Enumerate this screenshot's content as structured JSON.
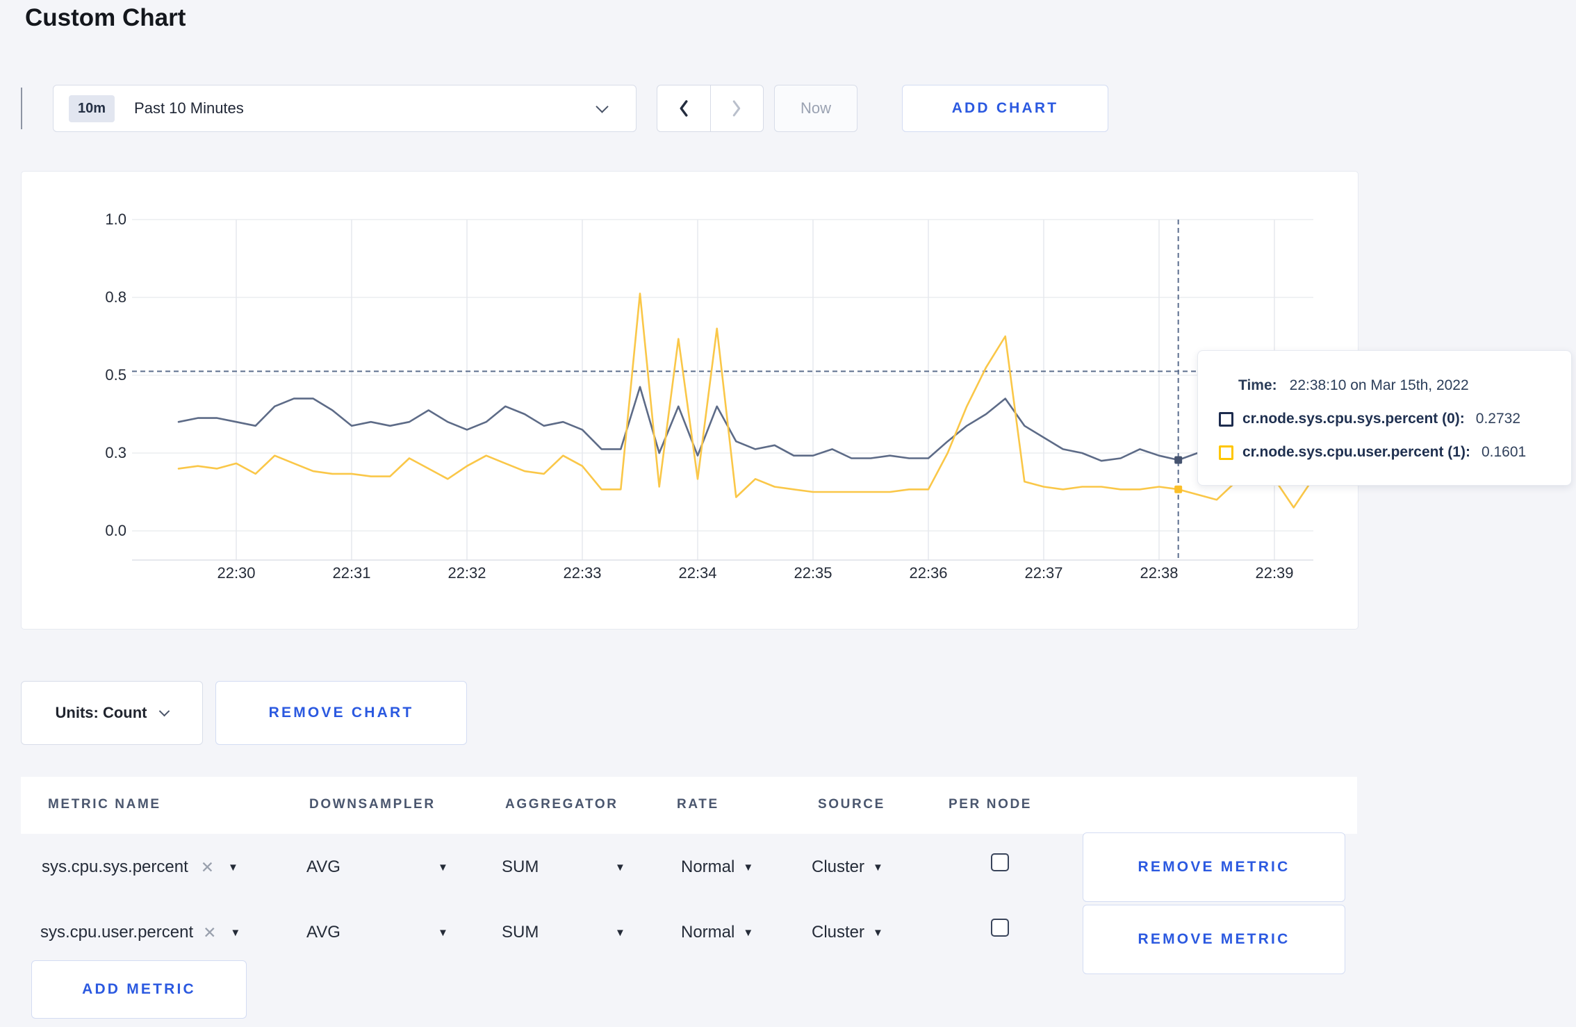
{
  "page": {
    "title": "Custom Chart"
  },
  "icons": {
    "close": "✕",
    "caret_down": "▼"
  },
  "toolbar": {
    "time_badge": "10m",
    "time_label": "Past 10 Minutes",
    "now_label": "Now",
    "add_chart_label": "ADD CHART"
  },
  "tooltip": {
    "time_label": "Time:",
    "time_value": "22:38:10 on Mar 15th, 2022",
    "series": [
      {
        "label": "cr.node.sys.cpu.sys.percent (0):",
        "value": "0.2732",
        "color": "#1d2c4e"
      },
      {
        "label": "cr.node.sys.cpu.user.percent (1):",
        "value": "0.1601",
        "color": "#ffc600"
      }
    ]
  },
  "chart_footer": {
    "units_label": "Units: Count",
    "remove_chart_label": "REMOVE CHART"
  },
  "metrics_table": {
    "headers": [
      "METRIC NAME",
      "DOWNSAMPLER",
      "AGGREGATOR",
      "RATE",
      "SOURCE",
      "PER NODE"
    ],
    "rows": [
      {
        "metric_name": "sys.cpu.sys.percent",
        "downsampler": "AVG",
        "aggregator": "SUM",
        "rate": "Normal",
        "source": "Cluster",
        "per_node_checked": false,
        "remove_label": "REMOVE METRIC"
      },
      {
        "metric_name": "sys.cpu.user.percent",
        "downsampler": "AVG",
        "aggregator": "SUM",
        "rate": "Normal",
        "source": "Cluster",
        "per_node_checked": false,
        "remove_label": "REMOVE METRIC"
      }
    ],
    "add_metric_label": "ADD METRIC"
  },
  "chart_data": {
    "type": "line",
    "title": "",
    "xlabel": "",
    "ylabel": "",
    "x_start_time": "22:29:30",
    "x_step_seconds": 10,
    "x_tick_labels": [
      "22:30",
      "22:31",
      "22:32",
      "22:33",
      "22:34",
      "22:35",
      "22:36",
      "22:37",
      "22:38",
      "22:39"
    ],
    "y_ticks": [
      {
        "value": 0,
        "label": "0.0"
      },
      {
        "value": 0.3,
        "label": "0.3"
      },
      {
        "value": 0.5,
        "label": "0.5"
      },
      {
        "value": 0.8,
        "label": "0.8"
      },
      {
        "value": 1.0,
        "label": "1.0"
      }
    ],
    "grid": true,
    "legend_position": "tooltip",
    "series": [
      {
        "name": "cr.node.sys.cpu.sys.percent",
        "color": "#5d6b87",
        "values": [
          0.38,
          0.39,
          0.39,
          0.38,
          0.37,
          0.42,
          0.44,
          0.44,
          0.41,
          0.37,
          0.38,
          0.37,
          0.38,
          0.41,
          0.38,
          0.36,
          0.38,
          0.42,
          0.4,
          0.37,
          0.38,
          0.36,
          0.31,
          0.31,
          0.47,
          0.3,
          0.42,
          0.29,
          0.42,
          0.33,
          0.31,
          0.32,
          0.29,
          0.29,
          0.31,
          0.28,
          0.28,
          0.29,
          0.28,
          0.28,
          0.33,
          0.37,
          0.4,
          0.44,
          0.37,
          0.34,
          0.31,
          0.3,
          0.27,
          0.28,
          0.31,
          0.29,
          0.2732,
          0.3,
          0.29,
          0.3,
          0.31,
          0.3,
          0.31,
          0.33
        ]
      },
      {
        "name": "cr.node.sys.cpu.user.percent",
        "color": "#fac748",
        "values": [
          0.24,
          0.25,
          0.24,
          0.26,
          0.22,
          0.29,
          0.26,
          0.23,
          0.22,
          0.22,
          0.21,
          0.21,
          0.28,
          0.24,
          0.2,
          0.25,
          0.29,
          0.26,
          0.23,
          0.22,
          0.29,
          0.25,
          0.16,
          0.16,
          0.81,
          0.17,
          0.64,
          0.2,
          0.68,
          0.13,
          0.2,
          0.17,
          0.16,
          0.15,
          0.15,
          0.15,
          0.15,
          0.15,
          0.16,
          0.16,
          0.3,
          0.42,
          0.53,
          0.65,
          0.19,
          0.17,
          0.16,
          0.17,
          0.17,
          0.16,
          0.16,
          0.17,
          0.1601,
          0.14,
          0.12,
          0.19,
          0.2,
          0.2,
          0.09,
          0.2
        ]
      }
    ],
    "crosshair": {
      "time": "22:38:10",
      "index": 52,
      "hline_value": 0.515,
      "values": [
        0.2732,
        0.1601
      ]
    }
  }
}
